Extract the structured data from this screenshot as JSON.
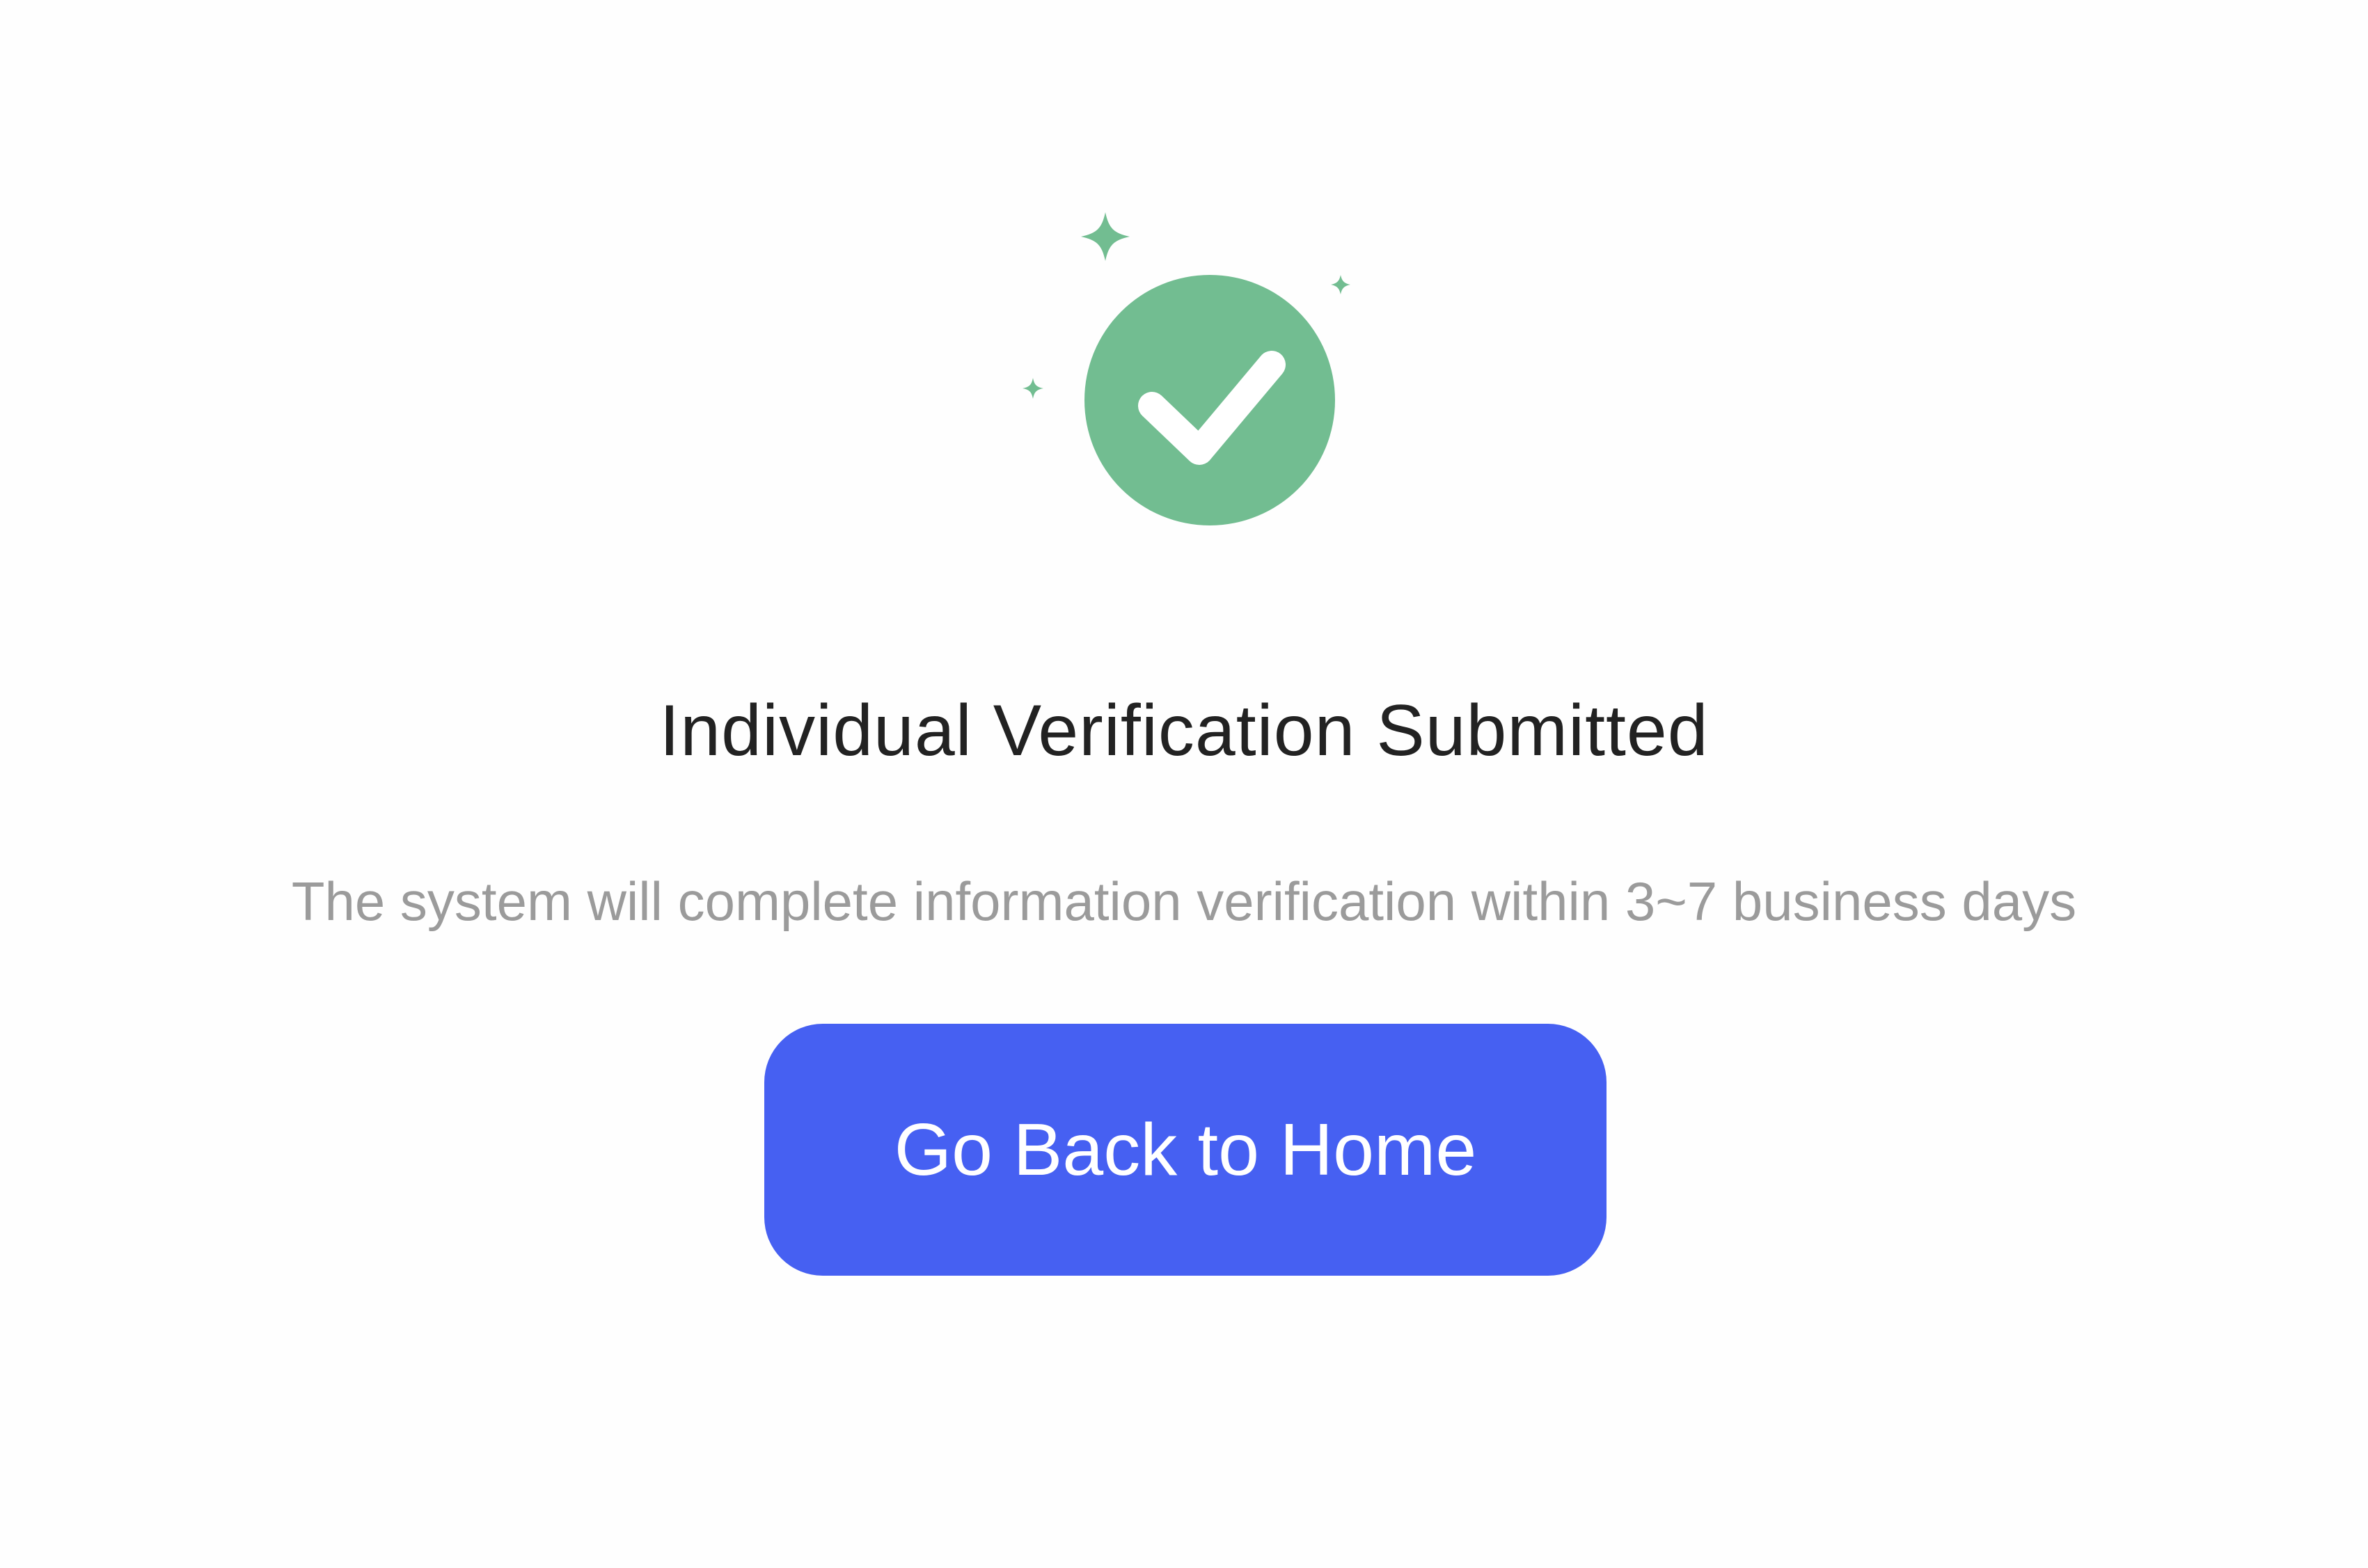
{
  "status": {
    "icon": "check-circle-icon",
    "sparkle_icon": "sparkle-icon",
    "accent_color": "#72bd91"
  },
  "content": {
    "title": "Individual Verification Submitted",
    "subtitle": "The system will complete information verification within 3~7 business days"
  },
  "actions": {
    "home_button_label": "Go Back to Home",
    "button_color": "#4660f2"
  }
}
